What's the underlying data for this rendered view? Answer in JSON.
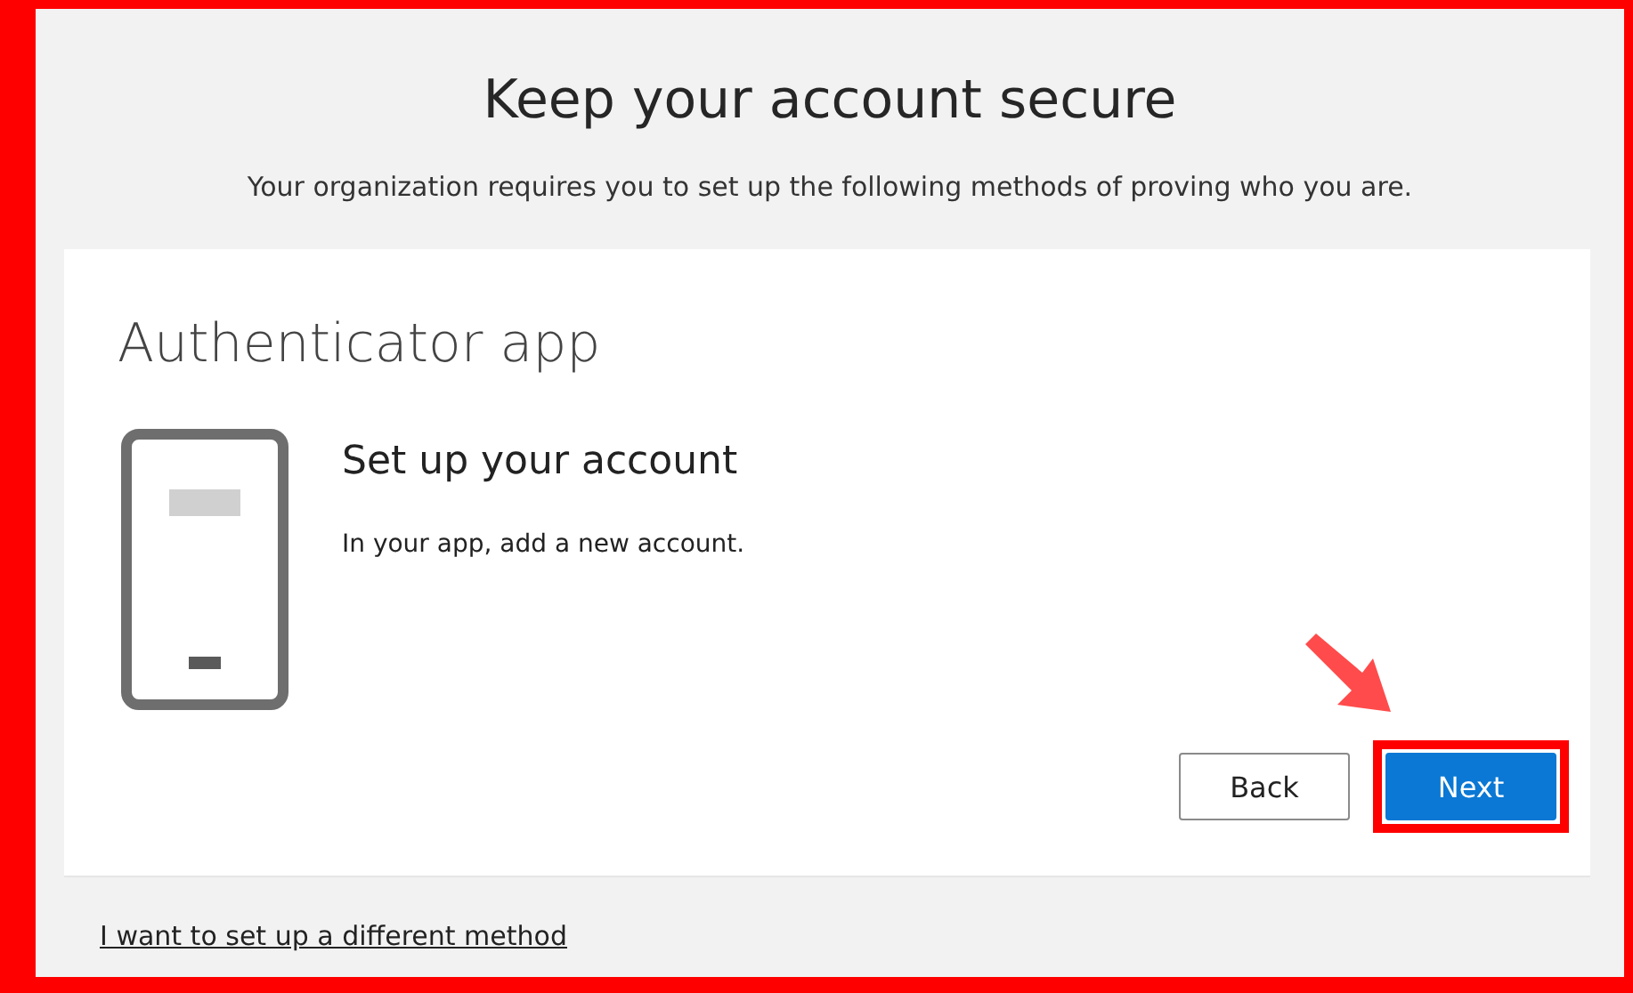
{
  "title": "Keep your account secure",
  "subtitle": "Your organization requires you to set up the following methods of proving who you are.",
  "card": {
    "heading": "Authenticator app",
    "step_title": "Set up your account",
    "step_text": "In your app, add a new account.",
    "buttons": [
      {
        "label": "Back",
        "kind": "secondary",
        "highlighted": false
      },
      {
        "label": "Next",
        "kind": "primary",
        "highlighted": true
      }
    ]
  },
  "footer_link": "I want to set up a different method"
}
